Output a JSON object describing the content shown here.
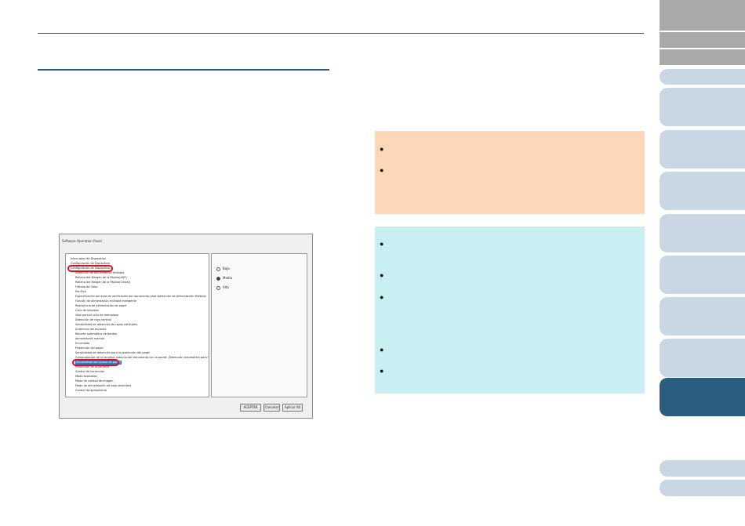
{
  "dialog": {
    "title": "Software Operation Panel",
    "tree_items": [
      {
        "text": "Interruptor de Dispositivo",
        "level": 0
      },
      {
        "text": "Configuración de Dispositivo",
        "level": 0
      },
      {
        "text": "Configuración de Dispositivo 2",
        "level": 0,
        "circled": true
      },
      {
        "text": "Detección de alimentación múltiple",
        "level": 1
      },
      {
        "text": "Relleno del Margen de la Página(ADF)",
        "level": 1
      },
      {
        "text": "Relleno del Margen de la Página(Cristal)",
        "level": 1
      },
      {
        "text": "Filtrado de Color",
        "level": 1
      },
      {
        "text": "Pre-Pick",
        "level": 1
      },
      {
        "text": "Especificación del área de verificación del documento para Detección de Alimentación Múltiple",
        "level": 1
      },
      {
        "text": "Función de alimentación múltiple inteligente",
        "level": 1
      },
      {
        "text": "Resistencia de alimentación de papel",
        "level": 1
      },
      {
        "text": "Ciclo de limpieza",
        "level": 1
      },
      {
        "text": "Vida para el ciclo de reemplazo",
        "level": 1
      },
      {
        "text": "Detección de rayo vertical",
        "level": 1
      },
      {
        "text": "Sensibilidad de detección de rayas verticales",
        "level": 1
      },
      {
        "text": "Autoinicio del escaneo",
        "level": 1
      },
      {
        "text": "Recorte automático de bordes",
        "level": 1
      },
      {
        "text": "Alimentación manual",
        "level": 1
      },
      {
        "text": "Encendido",
        "level": 1
      },
      {
        "text": "Protección del papel",
        "level": 1
      },
      {
        "text": "Sensibilidad de detección para la protección del papel",
        "level": 1
      },
      {
        "text": "Comprobación de la longitud máxima del documento con la opción (Detección Automática para Tamaño de Página)",
        "level": 1
      },
      {
        "text": "Sensibilidad del sensor de papel",
        "level": 1,
        "selected": true
      },
      {
        "text": "Protección de la pantalla",
        "level": 1
      },
      {
        "text": "Control de corrección",
        "level": 1
      },
      {
        "text": "Modo avanzado",
        "level": 1
      },
      {
        "text": "Modo de calidad de imagen",
        "level": 1
      },
      {
        "text": "Modo de alimentación de baja velocidad",
        "level": 1
      },
      {
        "text": "Control de apilamiento",
        "level": 1
      }
    ],
    "options": [
      {
        "label": "Baja",
        "checked": false
      },
      {
        "label": "Media",
        "checked": true
      },
      {
        "label": "Alta",
        "checked": false
      }
    ],
    "buttons": {
      "ok": "ACEPTAR",
      "cancel": "Cancelar",
      "apply": "Aplicar All"
    }
  },
  "colors": {
    "accent": "#2a5d80",
    "caution_bg": "#fcd8b8",
    "hint_bg": "#c8f0f2",
    "highlight": "#e0101a"
  }
}
